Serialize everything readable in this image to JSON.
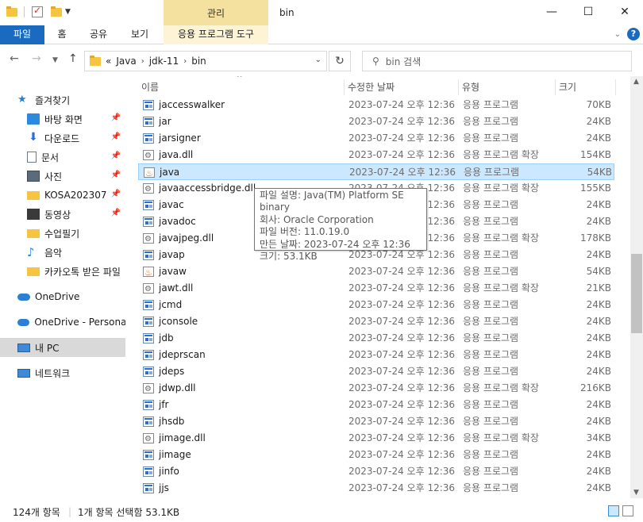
{
  "title": "bin",
  "context_tab": "관리",
  "ribbon": {
    "file": "파일",
    "tabs": [
      "홈",
      "공유",
      "보기"
    ],
    "context_sub": "응용 프로그램 도구"
  },
  "window_controls": {
    "minimize": "—",
    "maximize": "☐",
    "close": "✕"
  },
  "address": {
    "overflow": "«",
    "crumbs": [
      "Java",
      "jdk-11",
      "bin"
    ]
  },
  "search": {
    "placeholder": "bin 검색"
  },
  "sidebar": {
    "items": [
      {
        "label": "즐겨찾기",
        "icon": "star-icon"
      },
      {
        "label": "바탕 화면",
        "icon": "desktop-icon",
        "pinned": true
      },
      {
        "label": "다운로드",
        "icon": "download-icon",
        "pinned": true
      },
      {
        "label": "문서",
        "icon": "document-icon",
        "pinned": true
      },
      {
        "label": "사진",
        "icon": "pictures-icon",
        "pinned": true
      },
      {
        "label": "KOSA202307",
        "icon": "folder-icon",
        "pinned": true
      },
      {
        "label": "동영상",
        "icon": "video-icon",
        "pinned": true
      },
      {
        "label": "수업필기",
        "icon": "folder-icon"
      },
      {
        "label": "음악",
        "icon": "music-icon"
      },
      {
        "label": "카카오톡 받은 파일",
        "icon": "folder-icon"
      },
      {
        "label": "OneDrive",
        "icon": "cloud-icon"
      },
      {
        "label": "OneDrive - Personal",
        "icon": "cloud-icon"
      },
      {
        "label": "내 PC",
        "icon": "pc-icon",
        "selected": true
      },
      {
        "label": "네트워크",
        "icon": "network-icon"
      }
    ]
  },
  "columns": {
    "name": "이름",
    "date": "수정한 날짜",
    "type": "유형",
    "size": "크기"
  },
  "files": [
    {
      "name": "jaccesswalker",
      "date": "2023-07-24 오후 12:36",
      "type": "응용 프로그램",
      "size": "70KB",
      "icon": "exe"
    },
    {
      "name": "jar",
      "date": "2023-07-24 오후 12:36",
      "type": "응용 프로그램",
      "size": "24KB",
      "icon": "exe"
    },
    {
      "name": "jarsigner",
      "date": "2023-07-24 오후 12:36",
      "type": "응용 프로그램",
      "size": "24KB",
      "icon": "exe"
    },
    {
      "name": "java.dll",
      "date": "2023-07-24 오후 12:36",
      "type": "응용 프로그램 확장",
      "size": "154KB",
      "icon": "dll"
    },
    {
      "name": "java",
      "date": "2023-07-24 오후 12:36",
      "type": "응용 프로그램",
      "size": "54KB",
      "icon": "jv",
      "selected": true
    },
    {
      "name": "javaaccessbridge.dll",
      "date": "2023-07-24 오후 12:36",
      "type": "응용 프로그램 확장",
      "size": "155KB",
      "icon": "dll"
    },
    {
      "name": "javac",
      "date": "2023-07-24 오후 12:36",
      "type": "응용 프로그램",
      "size": "24KB",
      "icon": "exe"
    },
    {
      "name": "javadoc",
      "date": "2023-07-24 오후 12:36",
      "type": "응용 프로그램",
      "size": "24KB",
      "icon": "exe"
    },
    {
      "name": "javajpeg.dll",
      "date": "2023-07-24 오후 12:36",
      "type": "응용 프로그램 확장",
      "size": "178KB",
      "icon": "dll"
    },
    {
      "name": "javap",
      "date": "2023-07-24 오후 12:36",
      "type": "응용 프로그램",
      "size": "24KB",
      "icon": "exe"
    },
    {
      "name": "javaw",
      "date": "2023-07-24 오후 12:36",
      "type": "응용 프로그램",
      "size": "54KB",
      "icon": "jv"
    },
    {
      "name": "jawt.dll",
      "date": "2023-07-24 오후 12:36",
      "type": "응용 프로그램 확장",
      "size": "21KB",
      "icon": "dll"
    },
    {
      "name": "jcmd",
      "date": "2023-07-24 오후 12:36",
      "type": "응용 프로그램",
      "size": "24KB",
      "icon": "exe"
    },
    {
      "name": "jconsole",
      "date": "2023-07-24 오후 12:36",
      "type": "응용 프로그램",
      "size": "24KB",
      "icon": "exe"
    },
    {
      "name": "jdb",
      "date": "2023-07-24 오후 12:36",
      "type": "응용 프로그램",
      "size": "24KB",
      "icon": "exe"
    },
    {
      "name": "jdeprscan",
      "date": "2023-07-24 오후 12:36",
      "type": "응용 프로그램",
      "size": "24KB",
      "icon": "exe"
    },
    {
      "name": "jdeps",
      "date": "2023-07-24 오후 12:36",
      "type": "응용 프로그램",
      "size": "24KB",
      "icon": "exe"
    },
    {
      "name": "jdwp.dll",
      "date": "2023-07-24 오후 12:36",
      "type": "응용 프로그램 확장",
      "size": "216KB",
      "icon": "dll"
    },
    {
      "name": "jfr",
      "date": "2023-07-24 오후 12:36",
      "type": "응용 프로그램",
      "size": "24KB",
      "icon": "exe"
    },
    {
      "name": "jhsdb",
      "date": "2023-07-24 오후 12:36",
      "type": "응용 프로그램",
      "size": "24KB",
      "icon": "exe"
    },
    {
      "name": "jimage.dll",
      "date": "2023-07-24 오후 12:36",
      "type": "응용 프로그램 확장",
      "size": "34KB",
      "icon": "dll"
    },
    {
      "name": "jimage",
      "date": "2023-07-24 오후 12:36",
      "type": "응용 프로그램",
      "size": "24KB",
      "icon": "exe"
    },
    {
      "name": "jinfo",
      "date": "2023-07-24 오후 12:36",
      "type": "응용 프로그램",
      "size": "24KB",
      "icon": "exe"
    },
    {
      "name": "jjs",
      "date": "2023-07-24 오후 12:36",
      "type": "응용 프로그램",
      "size": "24KB",
      "icon": "exe"
    }
  ],
  "tooltip": [
    "파일 설명: Java(TM) Platform SE binary",
    "회사: Oracle Corporation",
    "파일 버전: 11.0.19.0",
    "만든 날짜: 2023-07-24 오후 12:36",
    "크기: 53.1KB"
  ],
  "status": {
    "count": "124개 항목",
    "selection": "1개 항목 선택함 53.1KB"
  },
  "scroll": {
    "position_fraction": 0.52,
    "visible_fraction": 0.2
  }
}
